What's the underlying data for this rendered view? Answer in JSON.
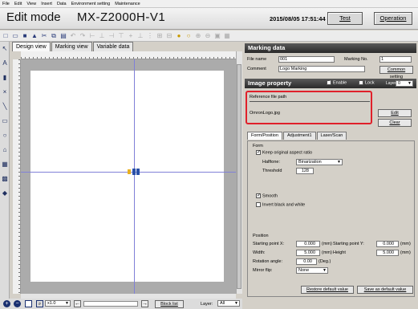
{
  "menu": [
    "File",
    "Edit",
    "View",
    "Insert",
    "Data",
    "Environment setting",
    "Maintenance"
  ],
  "title": {
    "mode": "Edit mode",
    "model": "MX-Z2000H-V1",
    "clock": "2015/08/05 17:51:44",
    "test_label": "Test",
    "operation_label": "Operation"
  },
  "tabs": [
    "Design view",
    "Marking view",
    "Variable data"
  ],
  "marking": {
    "header": "Marking data",
    "file_name_label": "File name",
    "file_name": "001",
    "marking_no_label": "Marking No.",
    "marking_no": "1",
    "comment_label": "Comment",
    "comment": "Logo Marking",
    "common_setting": "Common setting"
  },
  "image": {
    "header": "Image property",
    "enable_label": "Enable",
    "lock_label": "Lock",
    "layer_label": "Layer",
    "layer_value": "0",
    "ref_label": "Reference file path",
    "ref_value": "OmronLogo.jpg",
    "edit_label": "Edit",
    "clear_label": "Clear"
  },
  "subtabs": [
    "Form/Position",
    "Adjustment1",
    "Laser/Scan"
  ],
  "form": {
    "form_label": "Form",
    "keep_aspect": "Keep original aspect ratio",
    "halftone_label": "Halftone:",
    "halftone_value": "Binarization",
    "threshold_label": "Threshold",
    "threshold_value": "128",
    "smooth_label": "Smooth",
    "invert_label": "Invert black and white"
  },
  "position": {
    "label": "Position",
    "start_x_label": "Starting point X:",
    "start_x": "0.000",
    "unit_mm": "(mm)",
    "start_y_label": "Starting point Y:",
    "start_y": "0.000",
    "width_label": "Width:",
    "width": "5.000",
    "height_label": "Height",
    "height": "5.000",
    "rotation_label": "Rotation angle:",
    "rotation": "0.00",
    "deg": "(Deg.)",
    "mirror_label": "Mirror flip:",
    "mirror_value": "None"
  },
  "footer": {
    "restore_label": "Restore default value",
    "save_default_label": "Save as default value",
    "zoom": "x1.0",
    "block_list": "Block list",
    "layer_label": "Layer:",
    "layer_value": "All"
  }
}
